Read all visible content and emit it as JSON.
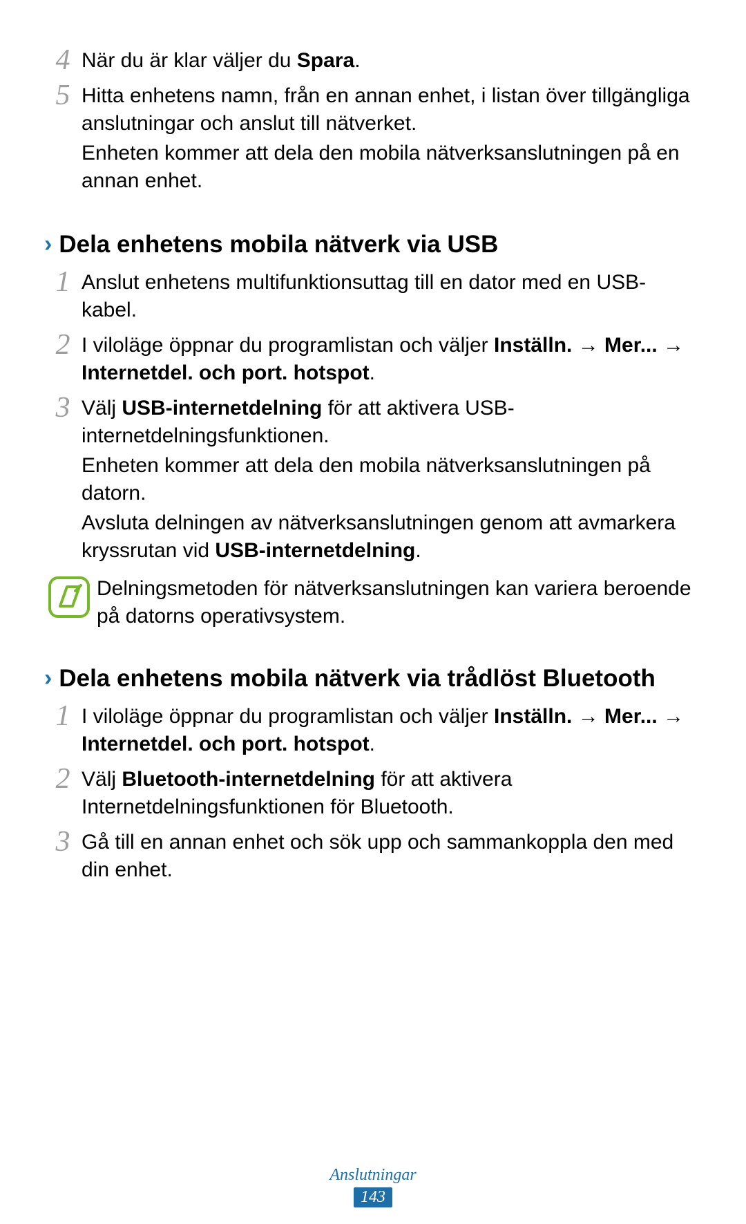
{
  "steps_continued": {
    "step4": {
      "num": "4",
      "text_pre": "När du är klar väljer du ",
      "text_bold": "Spara",
      "text_post": "."
    },
    "step5": {
      "num": "5",
      "line1": "Hitta enhetens namn, från en annan enhet, i listan över tillgängliga anslutningar och anslut till nätverket.",
      "line2": "Enheten kommer att dela den mobila nätverksanslutningen på en annan enhet."
    }
  },
  "section_usb": {
    "heading": "Dela enhetens mobila nätverk via USB",
    "step1": {
      "num": "1",
      "text": "Anslut enhetens multifunktionsuttag till en dator med en USB-kabel."
    },
    "step2": {
      "num": "2",
      "text_pre": "I viloläge öppnar du programlistan och väljer ",
      "bold1": "Inställn.",
      "arrow1": " → ",
      "bold2": "Mer...",
      "arrow2": " → ",
      "bold3": "Internetdel. och port. hotspot",
      "text_post": "."
    },
    "step3": {
      "num": "3",
      "line1_pre": "Välj ",
      "line1_bold": "USB-internetdelning",
      "line1_post": " för att aktivera USB-internetdelningsfunktionen.",
      "line2": "Enheten kommer att dela den mobila nätverksanslutningen på datorn.",
      "line3_pre": "Avsluta delningen av nätverksanslutningen genom att avmarkera kryssrutan vid ",
      "line3_bold": "USB-internetdelning",
      "line3_post": "."
    },
    "note": "Delningsmetoden för nätverksanslutningen kan variera beroende på datorns operativsystem."
  },
  "section_bt": {
    "heading": "Dela enhetens mobila nätverk via trådlöst Bluetooth",
    "step1": {
      "num": "1",
      "text_pre": "I viloläge öppnar du programlistan och väljer ",
      "bold1": "Inställn.",
      "arrow1": " → ",
      "bold2": "Mer...",
      "arrow2": " → ",
      "bold3": "Internetdel. och port. hotspot",
      "text_post": "."
    },
    "step2": {
      "num": "2",
      "text_pre": "Välj ",
      "text_bold": "Bluetooth-internetdelning",
      "text_post": " för att aktivera Internetdelningsfunktionen för Bluetooth."
    },
    "step3": {
      "num": "3",
      "text": "Gå till en annan enhet och sök upp och sammankoppla den med din enhet."
    }
  },
  "footer": {
    "category": "Anslutningar",
    "page": "143"
  },
  "icons": {
    "chevron": "›",
    "note": "note-icon"
  }
}
